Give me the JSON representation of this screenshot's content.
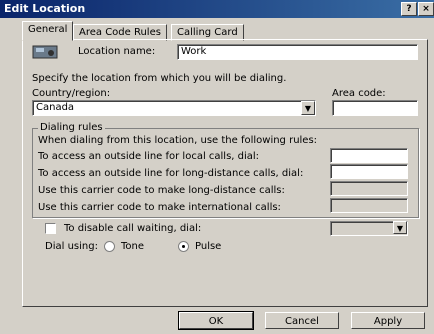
{
  "window": {
    "title": "Edit Location",
    "help_label": "?",
    "close_label": "×"
  },
  "tabs": [
    {
      "label": "General"
    },
    {
      "label": "Area Code Rules"
    },
    {
      "label": "Calling Card"
    }
  ],
  "general": {
    "location_name_label": "Location name:",
    "location_name_value": "Work",
    "specify_text": "Specify the location from which you will be dialing.",
    "country_label": "Country/region:",
    "country_value": "Canada",
    "area_code_label": "Area code:",
    "area_code_value": "",
    "dialing_rules": {
      "group_label": "Dialing rules",
      "intro": "When dialing from this location, use the following rules:",
      "local_label": "To access an outside line for local calls, dial:",
      "local_value": "",
      "long_distance_label": "To access an outside line for long-distance calls, dial:",
      "long_distance_value": "",
      "carrier_ld_label": "Use this carrier code to make long-distance calls:",
      "carrier_ld_value": "",
      "carrier_intl_label": "Use this carrier code to make international calls:",
      "carrier_intl_value": ""
    },
    "disable_call_waiting_label": "To disable call waiting, dial:",
    "disable_call_waiting_checked": false,
    "dial_using_label": "Dial using:",
    "dial_options": [
      {
        "label": "Tone",
        "selected": false
      },
      {
        "label": "Pulse",
        "selected": true
      }
    ]
  },
  "buttons": {
    "ok": "OK",
    "cancel": "Cancel",
    "apply": "Apply"
  },
  "colors": {
    "titlebar": "#0a246a",
    "face": "#d4d0c8"
  },
  "icons": {
    "location": "phone-location-icon"
  }
}
